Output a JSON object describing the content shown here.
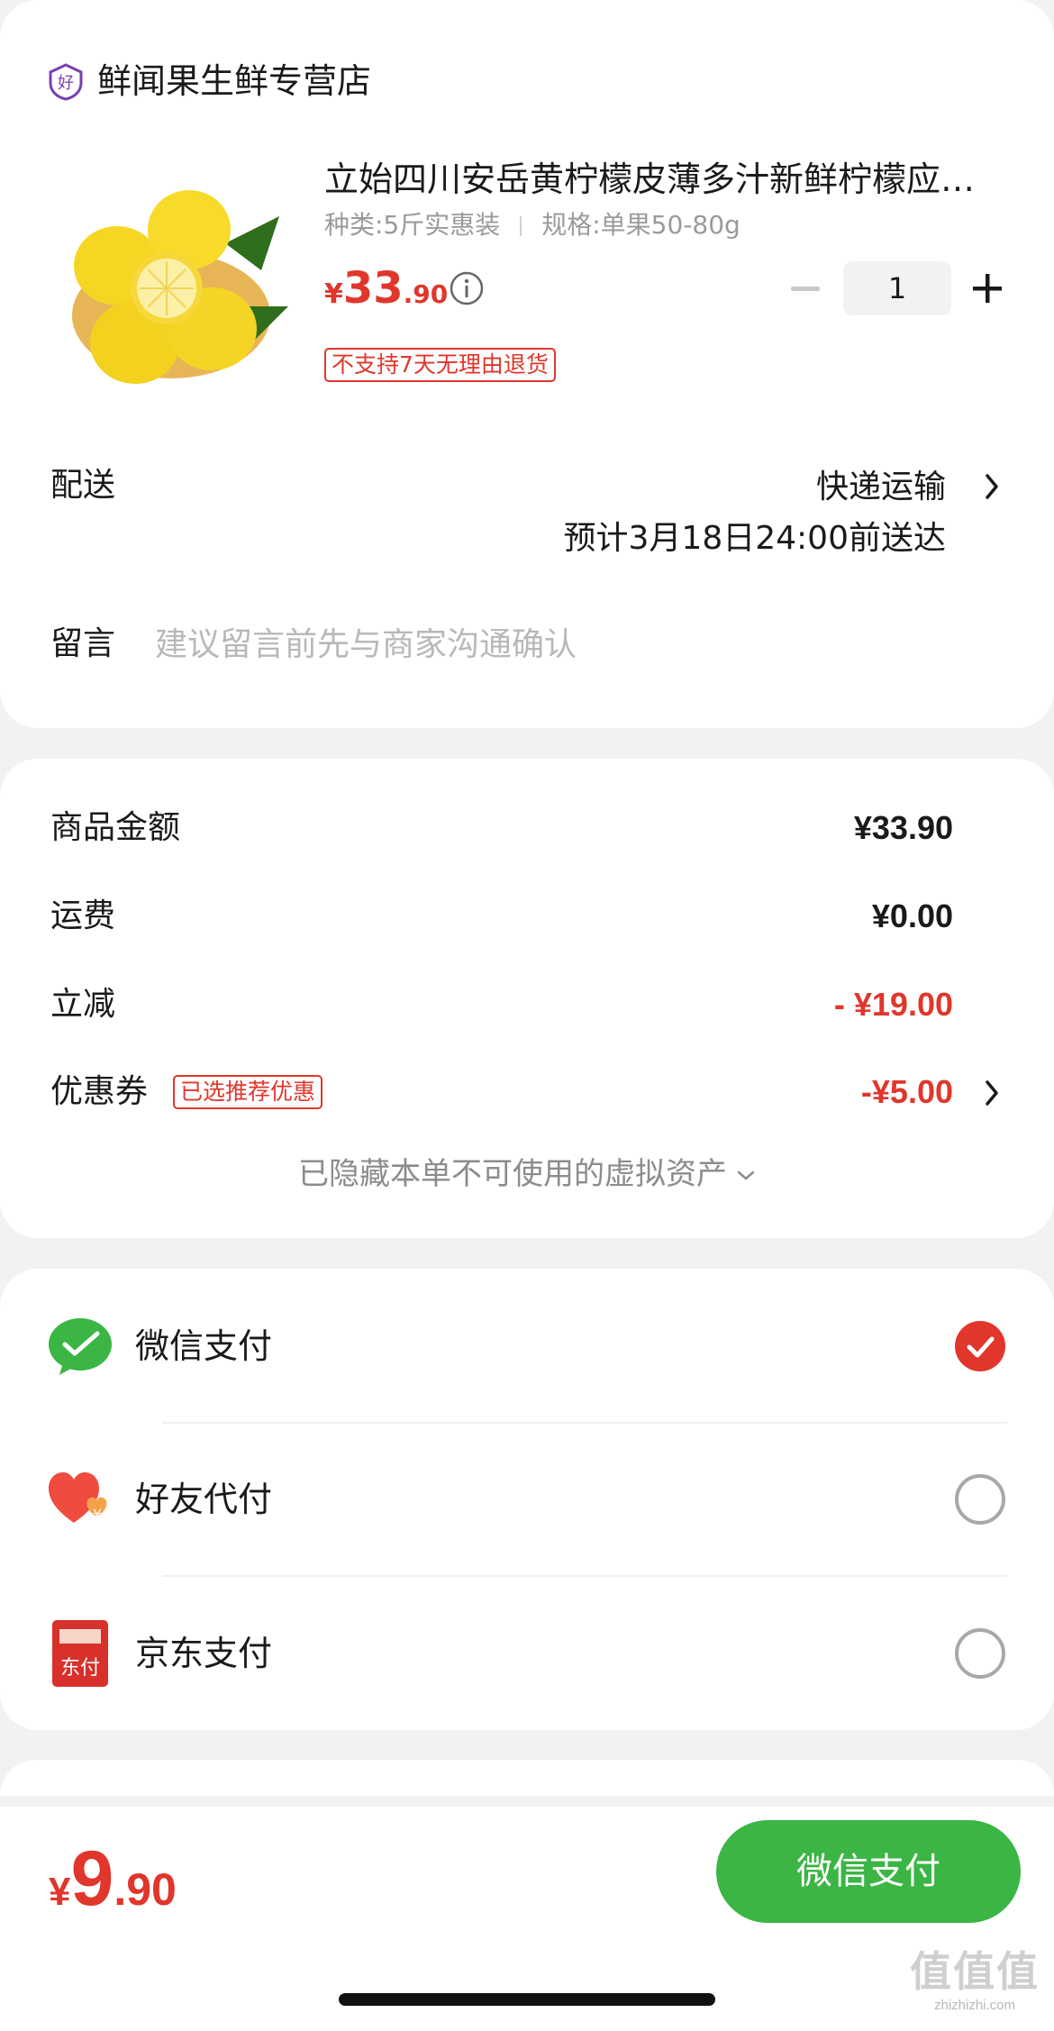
{
  "store": {
    "name": "鲜闻果生鲜专营店",
    "icon": "store-badge-icon"
  },
  "product": {
    "title": "立始四川安岳黄柠檬皮薄多汁新鲜柠檬应季水果",
    "spec_kind": "种类:5斤实惠装",
    "spec_size": "规格:单果50-80g",
    "price_currency": "¥",
    "price_int": "33",
    "price_dec": ".90",
    "quantity": "1",
    "return_tag": "不支持7天无理由退货"
  },
  "delivery": {
    "label": "配送",
    "method": "快递运输",
    "eta": "预计3月18日24:00前送达"
  },
  "message": {
    "label": "留言",
    "placeholder": "建议留言前先与商家沟通确认"
  },
  "amounts": {
    "goods_label": "商品金额",
    "goods_value": "¥33.90",
    "shipping_label": "运费",
    "shipping_value": "¥0.00",
    "discount_label": "立减",
    "discount_value": "-  ¥19.00",
    "coupon_label": "优惠券",
    "coupon_tag": "已选推荐优惠",
    "coupon_value": "-¥5.00",
    "hidden_assets": "已隐藏本单不可使用的虚拟资产"
  },
  "payment": {
    "methods": [
      {
        "label": "微信支付",
        "icon": "wechat-pay-icon",
        "selected": true
      },
      {
        "label": "好友代付",
        "icon": "friend-pay-icon",
        "selected": false
      },
      {
        "label": "京东支付",
        "icon": "jd-pay-icon",
        "selected": false
      }
    ]
  },
  "footer": {
    "total_currency": "¥",
    "total_int": "9",
    "total_dec": ".90",
    "pay_button": "微信支付"
  },
  "watermark": {
    "title": "值值值",
    "url": "zhizhizhi.com"
  },
  "colors": {
    "accent_red": "#e0362c",
    "wechat_green": "#3bb543",
    "background": "#f2f2f2"
  }
}
